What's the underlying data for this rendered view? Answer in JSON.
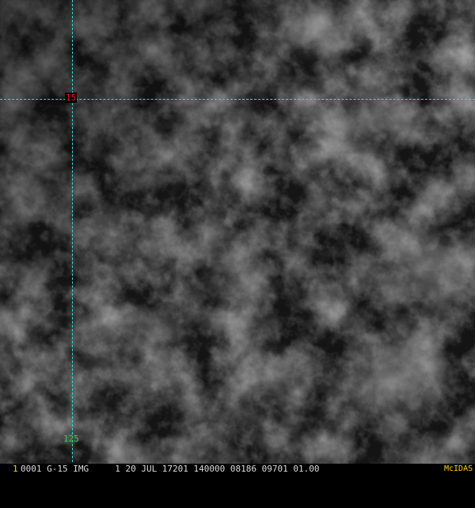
{
  "overlay": {
    "latitude_label": "15",
    "longitude_label": "125",
    "grid_color": "#3fd6d6",
    "latitude_label_color": "#e0201c",
    "longitude_label_color": "#22d822"
  },
  "status_bar": {
    "frame_number": "1",
    "header": "0001 G-15 IMG     1 20 JUL 17201 140000 08186 09701 01.00",
    "brand": "McIDAS",
    "text_color": "#dcdcdc",
    "accent_color": "#ffd400"
  }
}
